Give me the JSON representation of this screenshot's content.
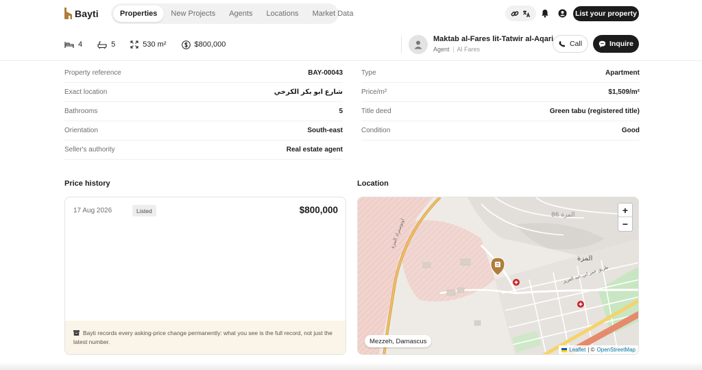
{
  "brand": {
    "name": "Bayti",
    "accent": "#b07d3b"
  },
  "nav": {
    "items": [
      {
        "label": "Properties",
        "active": true
      },
      {
        "label": "New Projects",
        "active": false
      },
      {
        "label": "Agents",
        "active": false
      },
      {
        "label": "Locations",
        "active": false
      },
      {
        "label": "Market Data",
        "active": false
      }
    ],
    "list_property_label": "List your property",
    "icons": [
      "link-icon",
      "translate-icon",
      "bell-icon",
      "user-icon"
    ]
  },
  "summary": {
    "bedrooms": "4",
    "bathrooms": "5",
    "area": "530 m²",
    "price": "$800,000"
  },
  "agent": {
    "name": "Maktab al-Fares lit-Tatwir al-Aqari",
    "role": "Agent",
    "company": "Al Fares",
    "verified": true,
    "call_label": "Call",
    "inquire_label": "Inquire"
  },
  "details": {
    "left": [
      {
        "label": "Property reference",
        "value": "BAY-00043"
      },
      {
        "label": "Exact location",
        "value": "شارع ابو بكر الكرخي"
      },
      {
        "label": "Bathrooms",
        "value": "5"
      },
      {
        "label": "Orientation",
        "value": "South-east"
      },
      {
        "label": "Seller's authority",
        "value": "Real estate agent"
      }
    ],
    "right": [
      {
        "label": "Type",
        "value": "Apartment"
      },
      {
        "label": "Price/m²",
        "value": "$1,509/m²"
      },
      {
        "label": "Title deed",
        "value": "Green tabu (registered title)"
      },
      {
        "label": "Condition",
        "value": "Good"
      }
    ]
  },
  "price_history": {
    "title": "Price history",
    "entries": [
      {
        "date": "17 Aug 2026",
        "status": "Listed",
        "price": "$800,000"
      }
    ],
    "note": "Bayti records every asking-price change permanently: what you see is the full record, not just the latest number."
  },
  "location": {
    "title": "Location",
    "place": "Mezzeh, Damascus",
    "zoom_in": "+",
    "zoom_out": "−",
    "attribution_leaflet": "Leaflet",
    "attribution_sep": "| ©",
    "attribution_osm": "OpenStreetMap",
    "map_labels": [
      "المزة 86",
      "المزة",
      "طريق عمر ابن عبد العزيز",
      "اوتوستراد المزة"
    ]
  }
}
